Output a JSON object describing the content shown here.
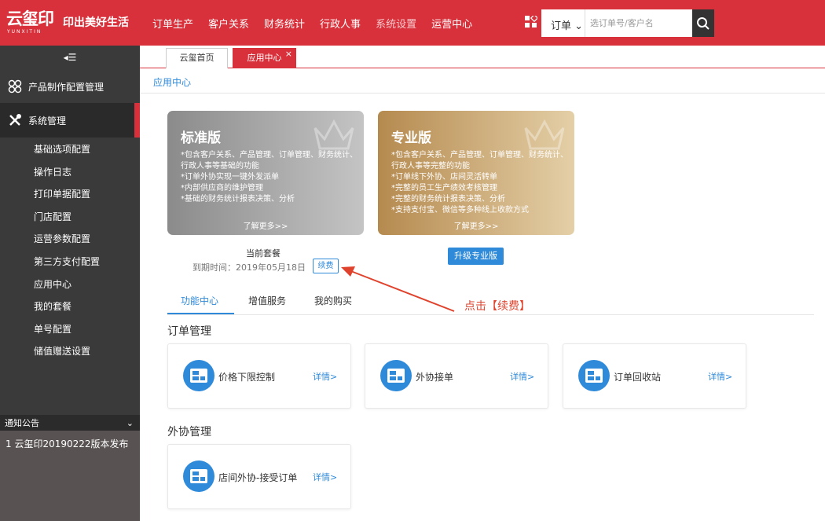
{
  "brand": {
    "logo_main": "云玺印",
    "logo_sub": "YUNXITIN",
    "slogan": "印出美好生活"
  },
  "nav": {
    "items": [
      "订单生产",
      "客户关系",
      "财务统计",
      "行政人事",
      "系统设置",
      "运营中心"
    ]
  },
  "search": {
    "type": "订单",
    "placeholder": "选订单号/客户名"
  },
  "sidebar": {
    "collapse_icon": "◂☰",
    "groups": [
      {
        "label": "产品制作配置管理",
        "icon": "link-icon"
      },
      {
        "label": "系统管理",
        "icon": "tools-icon"
      }
    ],
    "sub_items": [
      "基础选项配置",
      "操作日志",
      "打印单据配置",
      "门店配置",
      "运营参数配置",
      "第三方支付配置",
      "应用中心",
      "我的套餐",
      "单号配置",
      "储值赠送设置"
    ],
    "notice_title": "通知公告",
    "notice_items": [
      "1 云玺印20190222版本发布"
    ]
  },
  "tabs": [
    {
      "label": "云玺首页"
    },
    {
      "label": "应用中心"
    }
  ],
  "breadcrumb": "应用中心",
  "plans": [
    {
      "title": "标准版",
      "desc": [
        "*包含客户关系、产品管理、订单管理、财务统计、行政人事等基础的功能",
        "*订单外协实现一键外发派单",
        "*内部供应商的维护管理",
        "*基础的财务统计报表决策、分析"
      ],
      "more": "了解更多>>"
    },
    {
      "title": "专业版",
      "desc": [
        "*包含客户关系、产品管理、订单管理、财务统计、行政人事等完整的功能",
        "*订单线下外协、店间灵活转单",
        "*完整的员工生产绩效考核管理",
        "*完整的财务统计报表决策、分析",
        "*支持支付宝、微信等多种线上收款方式"
      ],
      "more": "了解更多>>"
    }
  ],
  "current_plan": {
    "label": "当前套餐",
    "expire": "到期时间：2019年05月18日",
    "renew": "续费"
  },
  "upgrade": "升级专业版",
  "hint": "点击【续费】",
  "function_tabs": [
    "功能中心",
    "增值服务",
    "我的购买"
  ],
  "sections": [
    {
      "title": "订单管理",
      "cards": [
        {
          "label": "价格下限控制",
          "detail": "详情>"
        },
        {
          "label": "外协接单",
          "detail": "详情>"
        },
        {
          "label": "订单回收站",
          "detail": "详情>"
        }
      ]
    },
    {
      "title": "外协管理",
      "cards": [
        {
          "label": "店间外协-接受订单",
          "detail": "详情>"
        }
      ]
    }
  ],
  "colors": {
    "brand_red": "#d9313b",
    "accent_blue": "#2f8ad9",
    "hint_red": "#e0432d"
  }
}
